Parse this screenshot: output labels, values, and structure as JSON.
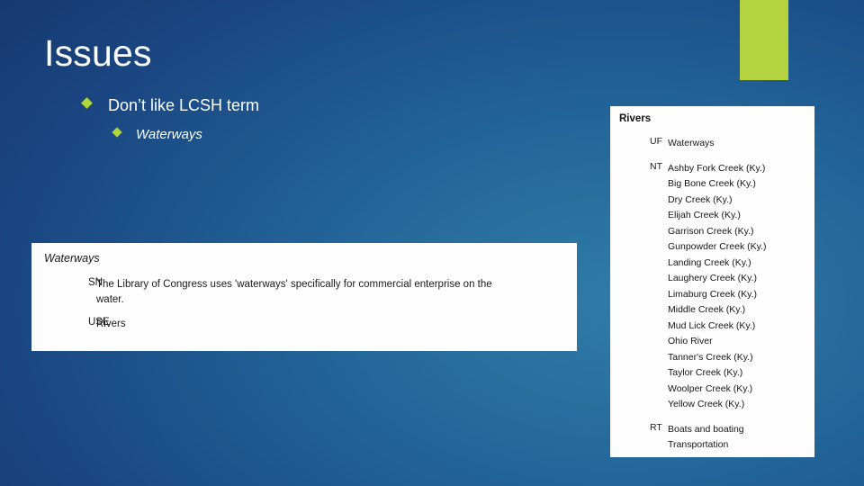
{
  "slide": {
    "title": "Issues",
    "accent_color": "#b3d43f",
    "background_dark": "#14306e",
    "background_light": "#2e7ba8",
    "bullets": [
      {
        "level": 1,
        "text": "Don’t like LCSH term",
        "marker": "diamond-bullet-icon"
      },
      {
        "level": 2,
        "text": "Waterways",
        "marker": "diamond-bullet-icon"
      }
    ]
  },
  "waterways_panel": {
    "heading": "Waterways",
    "rows": [
      {
        "label": "SN",
        "value": "The Library of Congress uses 'waterways' specifically for commercial enterprise on the water."
      },
      {
        "label": "USE",
        "value": "Rivers"
      }
    ]
  },
  "rivers_panel": {
    "heading": "Rivers",
    "rows": [
      {
        "label": "UF",
        "values": [
          "Waterways"
        ]
      },
      {
        "label": "NT",
        "values": [
          "Ashby Fork Creek (Ky.)",
          "Big Bone Creek (Ky.)",
          "Dry Creek (Ky.)",
          "Elijah Creek (Ky.)",
          "Garrison Creek (Ky.)",
          "Gunpowder Creek (Ky.)",
          "Landing Creek (Ky.)",
          "Laughery Creek (Ky.)",
          "Limaburg Creek (Ky.)",
          "Middle Creek (Ky.)",
          "Mud Lick Creek (Ky.)",
          "Ohio River",
          "Tanner's Creek (Ky.)",
          "Taylor Creek (Ky.)",
          "Woolper Creek (Ky.)",
          "Yellow Creek (Ky.)"
        ]
      },
      {
        "label": "RT",
        "values": [
          "Boats and boating",
          "Transportation"
        ]
      }
    ]
  }
}
